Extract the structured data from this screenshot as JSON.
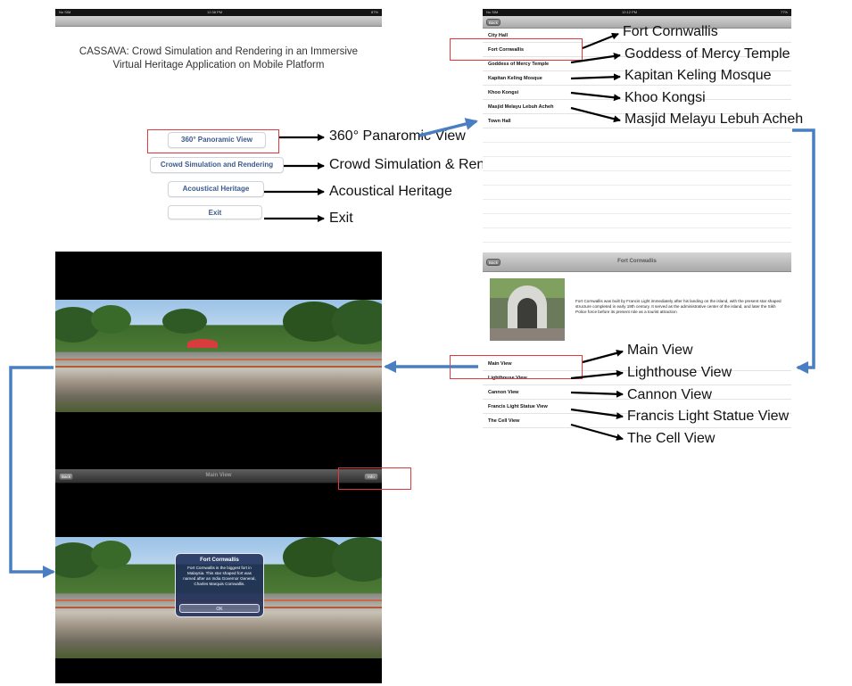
{
  "menu_screen": {
    "status_left": "No SIM",
    "status_center": "12:38 PM",
    "status_right": "87%",
    "title_line1": "CASSAVA: Crowd Simulation and Rendering in an Immersive",
    "title_line2": "Virtual Heritage Application on Mobile Platform",
    "buttons": {
      "panoramic": "360° Panoramic View",
      "crowd": "Crowd Simulation and Rendering",
      "acoustical": "Acoustical Heritage",
      "exit": "Exit"
    }
  },
  "menu_callouts": {
    "panoramic": "360° Panaromic View",
    "crowd": "Crowd Simulation & Rendering",
    "acoustical": "Acoustical Heritage",
    "exit": "Exit"
  },
  "site_list_screen": {
    "status_left": "No SIM",
    "status_center": "12:12 PM",
    "status_right": "77%",
    "back_label": "Back",
    "items": [
      "City Hall",
      "Fort Cornwallis",
      "Goddess of Mercy Temple",
      "Kapitan Keling Mosque",
      "Khoo Kongsi",
      "Masjid Melayu Lebuh Acheh",
      "Town Hall"
    ]
  },
  "site_callouts": [
    "Fort Cornwallis",
    "Goddess of Mercy Temple",
    "Kapitan Keling Mosque",
    "Khoo Kongsi",
    "Masjid Melayu Lebuh Acheh"
  ],
  "detail_screen": {
    "back_label": "Back",
    "title": "Fort Cornwallis",
    "description": "Fort Cornwallis was built by Francis Light immediately after his landing on the island, with the present star shaped structure completed in early 19th century. It served as the administrative center of the island, and later the Sikh Police force before its present role as a tourist attraction",
    "views": [
      "Main View",
      "Lighthouse View",
      "Cannon View",
      "Francis Light Statue View",
      "The Cell View"
    ]
  },
  "view_callouts": [
    "Main View",
    "Lighthouse View",
    "Cannon View",
    "Francis Light Statue View",
    "The Cell View"
  ],
  "panorama_screen": {
    "back_label": "Back",
    "title": "Main View",
    "info_label": "Info",
    "alert_title": "Fort Cornwallis",
    "alert_message": "Fort Cornwallis is the biggest fort in Malaysia. This star shaped fort was named after an India Governor General, Charles Marquis Cornwallis.",
    "alert_button": "OK"
  },
  "colors": {
    "annotation_red": "#e2393b",
    "flow_arrow_blue": "#4a7ec2",
    "callout_arrow": "#000000"
  }
}
